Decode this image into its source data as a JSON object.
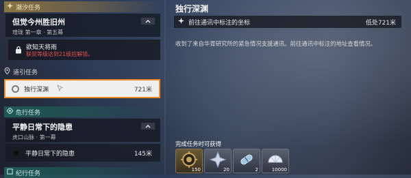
{
  "sections": {
    "tide": {
      "label": "潮汐任务"
    },
    "guide": {
      "label": "道引任务"
    },
    "danger": {
      "label": "危行任务"
    },
    "record": {
      "label": "纪行任务"
    }
  },
  "tide_card": {
    "title": "但觉今州胜旧州",
    "subtitle": "瑝珑 第一章 · 第五幕"
  },
  "locked_task": {
    "title": "欲知天将雨",
    "requirement": "联觉等级达到21级后解锁。"
  },
  "guide_task": {
    "name": "独行深渊",
    "distance": "721米"
  },
  "danger_card": {
    "title": "平静日常下的隐患",
    "subtitle": "虎口山脉 · 第一幕"
  },
  "danger_task": {
    "name": "平静日常下的隐患",
    "distance": "145米"
  },
  "detail": {
    "title": "独行深渊",
    "objective": "前往通讯中标注的坐标",
    "objective_distance": "低处721米",
    "description": "收到了来自华胥研究所的紧急情况支援通讯。前往通讯中标注的地址查看情况。",
    "rewards_label": "完成任务时可获得",
    "rewards": [
      {
        "icon": "gear-coin-icon",
        "qty": "150"
      },
      {
        "icon": "crystal-star-icon",
        "qty": "20"
      },
      {
        "icon": "capsule-icon",
        "qty": "2"
      },
      {
        "icon": "shell-credit-icon",
        "qty": "10000"
      }
    ]
  },
  "colors": {
    "highlight": "#f08a24",
    "lock_text": "#e05050",
    "tide_accent": "#8a7442",
    "danger_accent": "#1f5a56"
  }
}
